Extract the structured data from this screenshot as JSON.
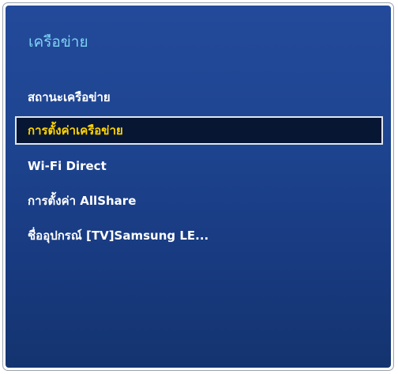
{
  "panel": {
    "title": "เครือข่าย"
  },
  "menu": {
    "items": [
      {
        "label": "สถานะเครือข่าย",
        "selected": false
      },
      {
        "label": "การตั้งค่าเครือข่าย",
        "selected": true
      },
      {
        "label": "Wi-Fi Direct",
        "selected": false
      },
      {
        "label": "การตั้งค่า AllShare",
        "selected": false
      },
      {
        "label": "ชื่ออุปกรณ์  [TV]Samsung LE...",
        "selected": false
      }
    ]
  },
  "colors": {
    "panel_bg": "#1e4591",
    "title_text": "#7fd3f5",
    "item_text": "#ffffff",
    "selected_text": "#ffd400",
    "selected_bg": "#071633",
    "selected_border": "#dfe6ee"
  }
}
